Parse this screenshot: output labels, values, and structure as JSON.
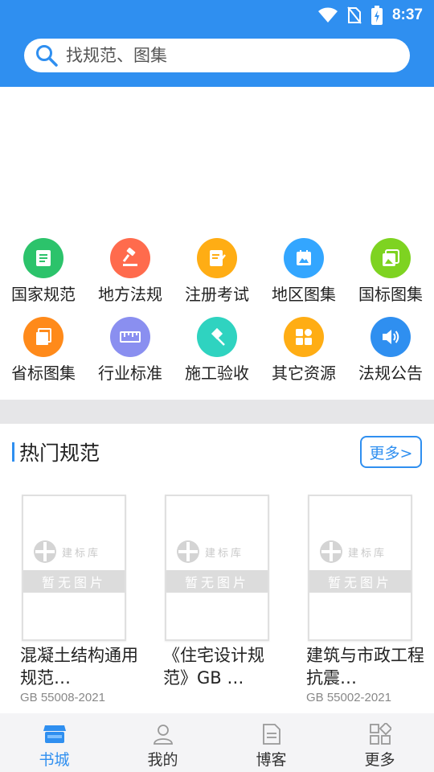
{
  "status": {
    "time": "8:37"
  },
  "search": {
    "placeholder": "找规范、图集"
  },
  "categories": [
    {
      "label": "国家规范",
      "color": "#2cc36b",
      "icon": "document-icon"
    },
    {
      "label": "地方法规",
      "color": "#ff6b4d",
      "icon": "gavel-icon"
    },
    {
      "label": "注册考试",
      "color": "#ffad14",
      "icon": "exam-icon"
    },
    {
      "label": "地区图集",
      "color": "#33a6ff",
      "icon": "image-icon"
    },
    {
      "label": "国标图集",
      "color": "#7ed321",
      "icon": "gallery-icon"
    },
    {
      "label": "省标图集",
      "color": "#ff8a1a",
      "icon": "stack-icon"
    },
    {
      "label": "行业标准",
      "color": "#8a8ff0",
      "icon": "ruler-icon"
    },
    {
      "label": "施工验收",
      "color": "#2fd3c0",
      "icon": "pin-icon"
    },
    {
      "label": "其它资源",
      "color": "#ffad14",
      "icon": "grid-icon"
    },
    {
      "label": "法规公告",
      "color": "#2f8ff0",
      "icon": "speaker-icon"
    }
  ],
  "hot": {
    "title": "热门规范",
    "more_label": "更多>"
  },
  "cover": {
    "logo_text": "建标库",
    "placeholder_text": "暂无图片"
  },
  "books": [
    {
      "title": "混凝土结构通用规范…",
      "code": "GB 55008-2021"
    },
    {
      "title": "《住宅设计规范》GB …",
      "code": ""
    },
    {
      "title": "建筑与市政工程抗震…",
      "code": "GB 55002-2021"
    }
  ],
  "tabs": [
    {
      "label": "书城",
      "icon": "store-icon",
      "active": true
    },
    {
      "label": "我的",
      "icon": "user-icon",
      "active": false
    },
    {
      "label": "博客",
      "icon": "blog-icon",
      "active": false
    },
    {
      "label": "更多",
      "icon": "more-icon",
      "active": false
    }
  ],
  "colors": {
    "primary": "#2f8ff0",
    "divider": "#e6e6e8",
    "tabbar": "#f4f4f6"
  }
}
